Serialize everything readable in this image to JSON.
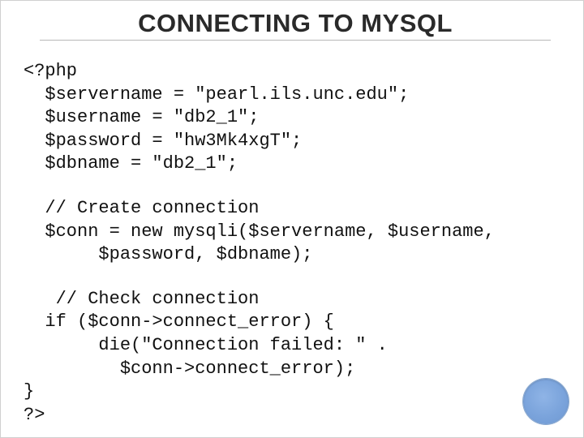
{
  "title": {
    "pre": "C",
    "word1_rest": "ONNECTING",
    "mid": " TO ",
    "word2_lead": "M",
    "word2_y": "Y",
    "word2_rest": "SQL"
  },
  "code": {
    "vars": "<?php\n  $servername = \"pearl.ils.unc.edu\";\n  $username = \"db2_1\";\n  $password = \"hw3Mk4xgT\";\n  $dbname = \"db2_1\";",
    "connect": "  // Create connection\n  $conn = new mysqli($servername, $username,\n       $password, $dbname);",
    "check": "   // Check connection\n  if ($conn->connect_error) {\n       die(\"Connection failed: \" .\n         $conn->connect_error);\n}\n?>"
  }
}
